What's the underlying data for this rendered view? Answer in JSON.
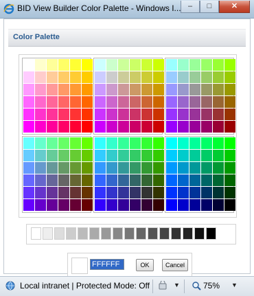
{
  "window": {
    "title": "BID View Builder Color Palette - Windows I..."
  },
  "header": {
    "title": "Color Palette"
  },
  "palette": {
    "blocks": [
      {
        "rows": [
          [
            "#FFFFFF",
            "#FFFFCC",
            "#FFFF99",
            "#FFFF66",
            "#FFFF33",
            "#FFFF00"
          ],
          [
            "#FFCCFF",
            "#FFCCCC",
            "#FFCC99",
            "#FFCC66",
            "#FFCC33",
            "#FFCC00"
          ],
          [
            "#FF99FF",
            "#FF99CC",
            "#FF9999",
            "#FF9966",
            "#FF9933",
            "#FF9900"
          ],
          [
            "#FF66FF",
            "#FF66CC",
            "#FF6699",
            "#FF6666",
            "#FF6633",
            "#FF6600"
          ],
          [
            "#FF33FF",
            "#FF33CC",
            "#FF3399",
            "#FF3366",
            "#FF3333",
            "#FF3300"
          ],
          [
            "#FF00FF",
            "#FF00CC",
            "#FF0099",
            "#FF0066",
            "#FF0033",
            "#FF0000"
          ]
        ]
      },
      {
        "rows": [
          [
            "#CCFFFF",
            "#CCFFCC",
            "#CCFF99",
            "#CCFF66",
            "#CCFF33",
            "#CCFF00"
          ],
          [
            "#CCCCFF",
            "#CCCCCC",
            "#CCCC99",
            "#CCCC66",
            "#CCCC33",
            "#CCCC00"
          ],
          [
            "#CC99FF",
            "#CC99CC",
            "#CC9999",
            "#CC9966",
            "#CC9933",
            "#CC9900"
          ],
          [
            "#CC66FF",
            "#CC66CC",
            "#CC6699",
            "#CC6666",
            "#CC6633",
            "#CC6600"
          ],
          [
            "#CC33FF",
            "#CC33CC",
            "#CC3399",
            "#CC3366",
            "#CC3333",
            "#CC3300"
          ],
          [
            "#CC00FF",
            "#CC00CC",
            "#CC0099",
            "#CC0066",
            "#CC0033",
            "#CC0000"
          ]
        ]
      },
      {
        "rows": [
          [
            "#99FFFF",
            "#99FFCC",
            "#99FF99",
            "#99FF66",
            "#99FF33",
            "#99FF00"
          ],
          [
            "#99CCFF",
            "#99CCCC",
            "#99CC99",
            "#99CC66",
            "#99CC33",
            "#99CC00"
          ],
          [
            "#9999FF",
            "#9999CC",
            "#999999",
            "#999966",
            "#999933",
            "#999900"
          ],
          [
            "#9966FF",
            "#9966CC",
            "#996699",
            "#996666",
            "#996633",
            "#996600"
          ],
          [
            "#9933FF",
            "#9933CC",
            "#993399",
            "#993366",
            "#993333",
            "#993300"
          ],
          [
            "#9900FF",
            "#9900CC",
            "#990099",
            "#990066",
            "#990033",
            "#990000"
          ]
        ]
      },
      {
        "rows": [
          [
            "#66FFFF",
            "#66FFCC",
            "#66FF99",
            "#66FF66",
            "#66FF33",
            "#66FF00"
          ],
          [
            "#66CCFF",
            "#66CCCC",
            "#66CC99",
            "#66CC66",
            "#66CC33",
            "#66CC00"
          ],
          [
            "#6699FF",
            "#6699CC",
            "#669999",
            "#669966",
            "#669933",
            "#669900"
          ],
          [
            "#6666FF",
            "#6666CC",
            "#666699",
            "#666666",
            "#666633",
            "#666600"
          ],
          [
            "#6633FF",
            "#6633CC",
            "#663399",
            "#663366",
            "#663333",
            "#663300"
          ],
          [
            "#6600FF",
            "#6600CC",
            "#660099",
            "#660066",
            "#660033",
            "#660000"
          ]
        ]
      },
      {
        "rows": [
          [
            "#33FFFF",
            "#33FFCC",
            "#33FF99",
            "#33FF66",
            "#33FF33",
            "#33FF00"
          ],
          [
            "#33CCFF",
            "#33CCCC",
            "#33CC99",
            "#33CC66",
            "#33CC33",
            "#33CC00"
          ],
          [
            "#3399FF",
            "#3399CC",
            "#339999",
            "#339966",
            "#339933",
            "#339900"
          ],
          [
            "#3366FF",
            "#3366CC",
            "#336699",
            "#336666",
            "#336633",
            "#336600"
          ],
          [
            "#3333FF",
            "#3333CC",
            "#333399",
            "#333366",
            "#333333",
            "#333300"
          ],
          [
            "#3300FF",
            "#3300CC",
            "#330099",
            "#330066",
            "#330033",
            "#330000"
          ]
        ]
      },
      {
        "rows": [
          [
            "#00FFFF",
            "#00FFCC",
            "#00FF99",
            "#00FF66",
            "#00FF33",
            "#00FF00"
          ],
          [
            "#00CCFF",
            "#00CCCC",
            "#00CC99",
            "#00CC66",
            "#00CC33",
            "#00CC00"
          ],
          [
            "#0099FF",
            "#0099CC",
            "#009999",
            "#009966",
            "#009933",
            "#009900"
          ],
          [
            "#0066FF",
            "#0066CC",
            "#006699",
            "#006666",
            "#006633",
            "#006600"
          ],
          [
            "#0033FF",
            "#0033CC",
            "#003399",
            "#003366",
            "#003333",
            "#003300"
          ],
          [
            "#0000FF",
            "#0000CC",
            "#000099",
            "#000066",
            "#000033",
            "#000000"
          ]
        ]
      }
    ],
    "grays": [
      "#FFFFFF",
      "#EEEEEE",
      "#DDDDDD",
      "#CCCCCC",
      "#BBBBBB",
      "#AAAAAA",
      "#999999",
      "#888888",
      "#777777",
      "#666666",
      "#555555",
      "#444444",
      "#333333",
      "#222222",
      "#111111",
      "#000000"
    ]
  },
  "controls": {
    "hex_value": "FFFFFF",
    "preview_color": "#FFFFFF",
    "ok_label": "OK",
    "cancel_label": "Cancel"
  },
  "statusbar": {
    "zone_text": "Local intranet | Protected Mode: Off",
    "zoom_text": "75%"
  },
  "colors": {
    "header_title": "#2A5B8F",
    "title_bar": "#B5CBDF"
  }
}
